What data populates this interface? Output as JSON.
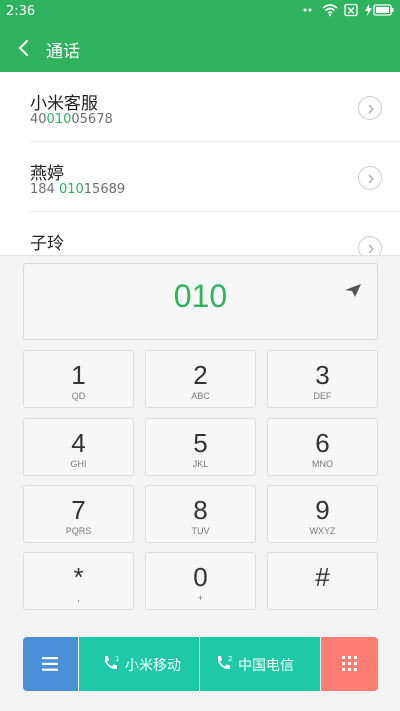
{
  "status_bar": {
    "time": "2:36",
    "icons": [
      "dots-icon",
      "wifi-icon",
      "no-sim-icon",
      "battery-charging-icon"
    ]
  },
  "app_bar": {
    "title": "通话",
    "back_icon": "chevron-left-icon"
  },
  "contacts": [
    {
      "name": "小米客服",
      "number_pre": "40",
      "number_match": "010",
      "number_post": "05678"
    },
    {
      "name": "燕婷",
      "number_pre": "184 ",
      "number_match": "010",
      "number_post": "15689"
    },
    {
      "name": "子玲",
      "number_pre": "",
      "number_match": "",
      "number_post": ""
    }
  ],
  "dialer": {
    "dialed_number": "010",
    "keys": [
      {
        "digit": "1",
        "letters": "QD"
      },
      {
        "digit": "2",
        "letters": "ABC"
      },
      {
        "digit": "3",
        "letters": "DEF"
      },
      {
        "digit": "4",
        "letters": "GHI"
      },
      {
        "digit": "5",
        "letters": "JKL"
      },
      {
        "digit": "6",
        "letters": "MNO"
      },
      {
        "digit": "7",
        "letters": "PQRS"
      },
      {
        "digit": "8",
        "letters": "TUV"
      },
      {
        "digit": "9",
        "letters": "WXYZ"
      },
      {
        "digit": "*",
        "letters": ","
      },
      {
        "digit": "0",
        "letters": "+"
      },
      {
        "digit": "#",
        "letters": ""
      }
    ]
  },
  "bottom_bar": {
    "sim1_label": "小米移动",
    "sim2_label": "中国电信",
    "sim1_number": "1",
    "sim2_number": "2"
  },
  "colors": {
    "brand": "#2fb35f",
    "menu_button": "#4a90d9",
    "call_button": "#1ec9a8",
    "keypad_toggle": "#ff7e73"
  }
}
